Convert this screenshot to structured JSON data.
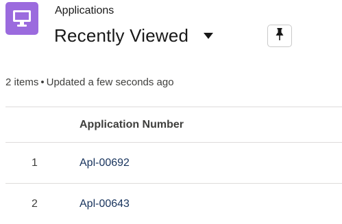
{
  "header": {
    "object_label": "Applications",
    "list_view_title": "Recently Viewed",
    "app_icon": "monitor-icon",
    "caret_icon": "caret-down-icon",
    "pin_icon": "pin-icon",
    "icon_color": "#9b6bde"
  },
  "status": {
    "item_count": "2 items",
    "separator": "•",
    "updated": "Updated a few seconds ago"
  },
  "table": {
    "columns": [
      "",
      "Application Number"
    ],
    "rows": [
      {
        "num": "1",
        "name": "Apl-00692"
      },
      {
        "num": "2",
        "name": "Apl-00643"
      }
    ]
  },
  "colors": {
    "link": "#16325c",
    "border": "#dddbda",
    "text": "#181818",
    "muted": "#3e3e3c"
  }
}
